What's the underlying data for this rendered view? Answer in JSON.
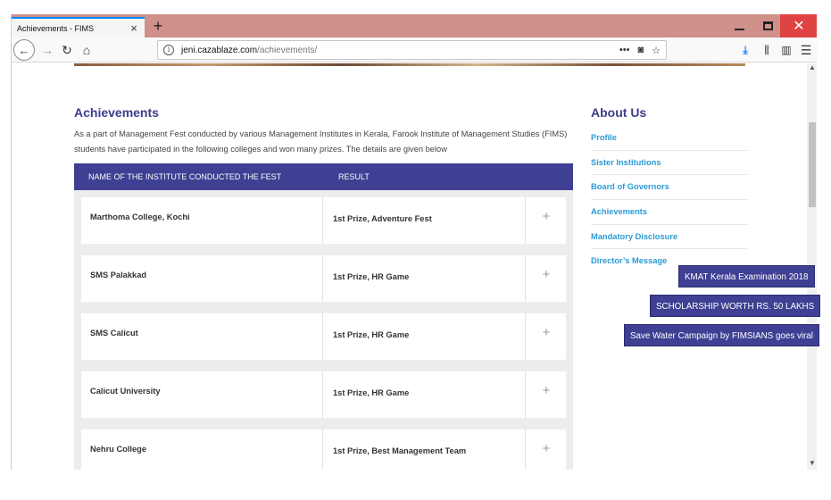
{
  "browser": {
    "tab_title": "Achievements - FIMS",
    "tab_close": "×",
    "new_tab": "+",
    "url_host": "jeni.cazablaze.com",
    "url_path": "/achievements/",
    "icons": [
      "back-icon",
      "forward-icon",
      "reload-icon",
      "home-icon",
      "info-icon",
      "more-icon",
      "pocket-icon",
      "bookmark-star-icon",
      "download-icon",
      "library-icon",
      "sidebar-icon",
      "menu-icon"
    ]
  },
  "page": {
    "title": "Achievements",
    "intro": "As a part of Management Fest conducted by various Management Institutes in Kerala, Farook Institute of Management Studies (FIMS) students have participated in the following colleges and won many prizes. The details are given below",
    "table": {
      "headers": [
        "NAME OF THE INSTITUTE CONDUCTED THE FEST",
        "RESULT"
      ],
      "rows": [
        {
          "institute": "Marthoma College, Kochi",
          "result": "1st Prize, Adventure Fest",
          "toggle": "+"
        },
        {
          "institute": "SMS Palakkad",
          "result": "1st Prize, HR Game",
          "toggle": "+"
        },
        {
          "institute": "SMS Calicut",
          "result": "1st Prize, HR Game",
          "toggle": "+"
        },
        {
          "institute": "Calicut University",
          "result": "1st Prize, HR Game",
          "toggle": "+"
        },
        {
          "institute": "Nehru College",
          "result": "1st Prize, Best Management Team",
          "toggle": "+"
        }
      ]
    }
  },
  "sidebar": {
    "title": "About Us",
    "items": [
      "Profile",
      "Sister Institutions",
      "Board of Governors",
      "Achievements",
      "Mandatory Disclosure",
      "Director’s Message"
    ]
  },
  "notices": [
    "KMAT Kerala Examination 2018",
    "SCHOLARSHIP WORTH RS. 50 LAKHS",
    "Save Water Campaign by FIMSIANS goes viral"
  ],
  "colors": {
    "brand": "#3f3f93",
    "link": "#2b9ad6",
    "tabbar": "#d0918b",
    "close": "#e04343"
  }
}
